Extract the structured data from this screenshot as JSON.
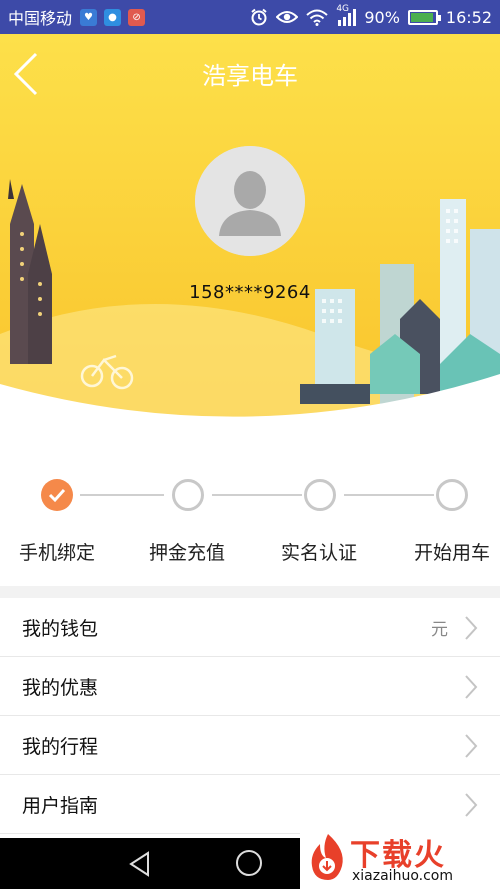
{
  "status_bar": {
    "carrier": "中国移动",
    "network": "4G",
    "battery": "90%",
    "battery_level": 0.9,
    "time": "16:52"
  },
  "header": {
    "title": "浩享电车"
  },
  "profile": {
    "phone": "158****9264"
  },
  "steps": [
    {
      "label": "手机绑定",
      "done": true
    },
    {
      "label": "押金充值",
      "done": false
    },
    {
      "label": "实名认证",
      "done": false
    },
    {
      "label": "开始用车",
      "done": false
    }
  ],
  "menu": [
    {
      "label": "我的钱包",
      "value": "元"
    },
    {
      "label": "我的优惠",
      "value": ""
    },
    {
      "label": "我的行程",
      "value": ""
    },
    {
      "label": "用户指南",
      "value": ""
    }
  ],
  "watermark": {
    "text": "下载火",
    "sub": "xiazaihuo.com"
  },
  "colors": {
    "status_bar": "#3d4aa8",
    "banner": "#fbd13a",
    "step_done": "#f5894a",
    "watermark": "#e8402a"
  }
}
